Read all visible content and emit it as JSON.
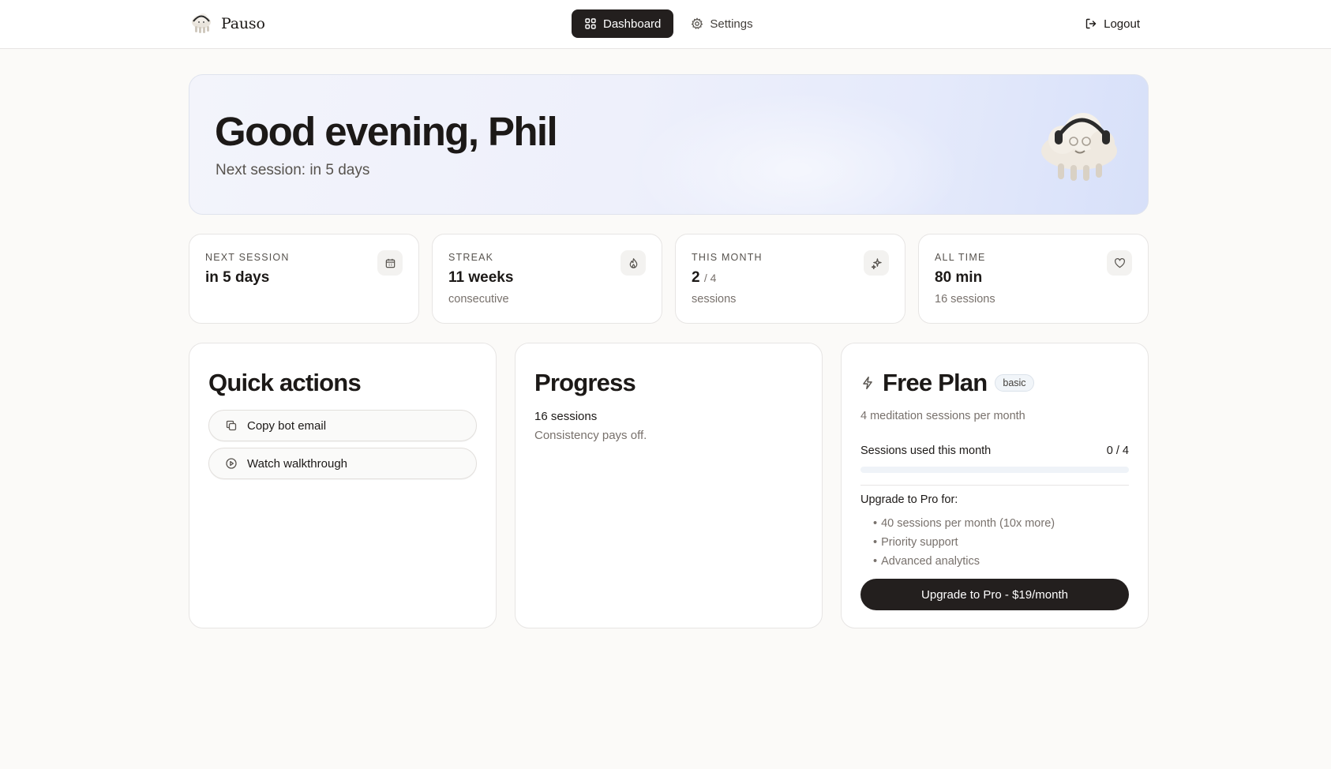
{
  "app": {
    "name": "Pauso"
  },
  "nav": {
    "items": [
      {
        "label": "Dashboard",
        "icon": "dashboard-grid-icon",
        "active": true
      },
      {
        "label": "Settings",
        "icon": "gear-icon",
        "active": false
      }
    ],
    "logout_label": "Logout"
  },
  "hero": {
    "greeting": "Good evening, Phil",
    "subtitle": "Next session: in 5 days"
  },
  "stats": [
    {
      "label": "NEXT SESSION",
      "value": "in 5 days",
      "denominator": "",
      "sub": "",
      "icon": "calendar-icon"
    },
    {
      "label": "STREAK",
      "value": "11 weeks",
      "denominator": "",
      "sub": "consecutive",
      "icon": "flame-icon"
    },
    {
      "label": "THIS MONTH",
      "value": "2",
      "denominator": "/ 4",
      "sub": "sessions",
      "icon": "sparkles-icon"
    },
    {
      "label": "ALL TIME",
      "value": "80 min",
      "denominator": "",
      "sub": "16 sessions",
      "icon": "heart-icon"
    }
  ],
  "quick_actions": {
    "title": "Quick actions",
    "buttons": [
      {
        "label": "Copy bot email",
        "icon": "copy-icon"
      },
      {
        "label": "Watch walkthrough",
        "icon": "play-circle-icon"
      }
    ]
  },
  "progress": {
    "title": "Progress",
    "count": "16 sessions",
    "note": "Consistency pays off."
  },
  "plan": {
    "title": "Free Plan",
    "badge": "basic",
    "description": "4 meditation sessions per month",
    "usage_label": "Sessions used this month",
    "usage_count": "0 / 4",
    "usage_fraction": 0,
    "upgrade_heading": "Upgrade to Pro for:",
    "perks": [
      "40 sessions per month (10x more)",
      "Priority support",
      "Advanced analytics"
    ],
    "upgrade_button": "Upgrade to Pro - $19/month"
  },
  "colors": {
    "background": "#fbfaf8",
    "primary": "#231f1e",
    "hero_gradient_end": "#d7e0f9"
  }
}
